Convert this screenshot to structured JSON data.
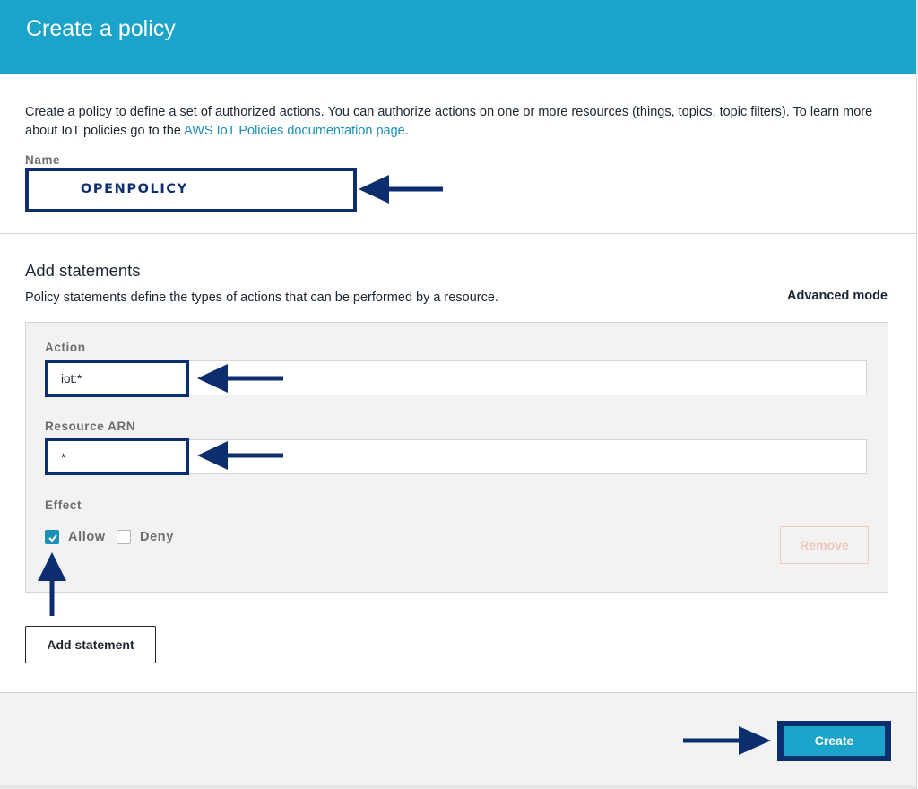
{
  "header": {
    "title": "Create a policy"
  },
  "intro": {
    "text": "Create a policy to define a set of authorized actions. You can authorize actions on one or more resources (things, topics, topic filters). To learn more about IoT policies go to the ",
    "link": "AWS IoT Policies documentation page",
    "end": "."
  },
  "name_field": {
    "label": "Name",
    "value": "OPENPOLICY"
  },
  "statements": {
    "title": "Add statements",
    "subtitle": "Policy statements define the types of actions that can be performed by a resource.",
    "advanced_mode": "Advanced mode",
    "action": {
      "label": "Action",
      "value": "iot:*"
    },
    "resource": {
      "label": "Resource ARN",
      "value": "*"
    },
    "effect": {
      "label": "Effect",
      "options": [
        {
          "label": "Allow",
          "checked": true
        },
        {
          "label": "Deny",
          "checked": false
        }
      ]
    },
    "remove_label": "Remove",
    "add_label": "Add statement"
  },
  "footer": {
    "create_label": "Create"
  },
  "colors": {
    "header_bg": "#1ba3c9",
    "annotation": "#0c2e6e",
    "link": "#1a8fb7",
    "checkbox": "#1a8fb7"
  }
}
